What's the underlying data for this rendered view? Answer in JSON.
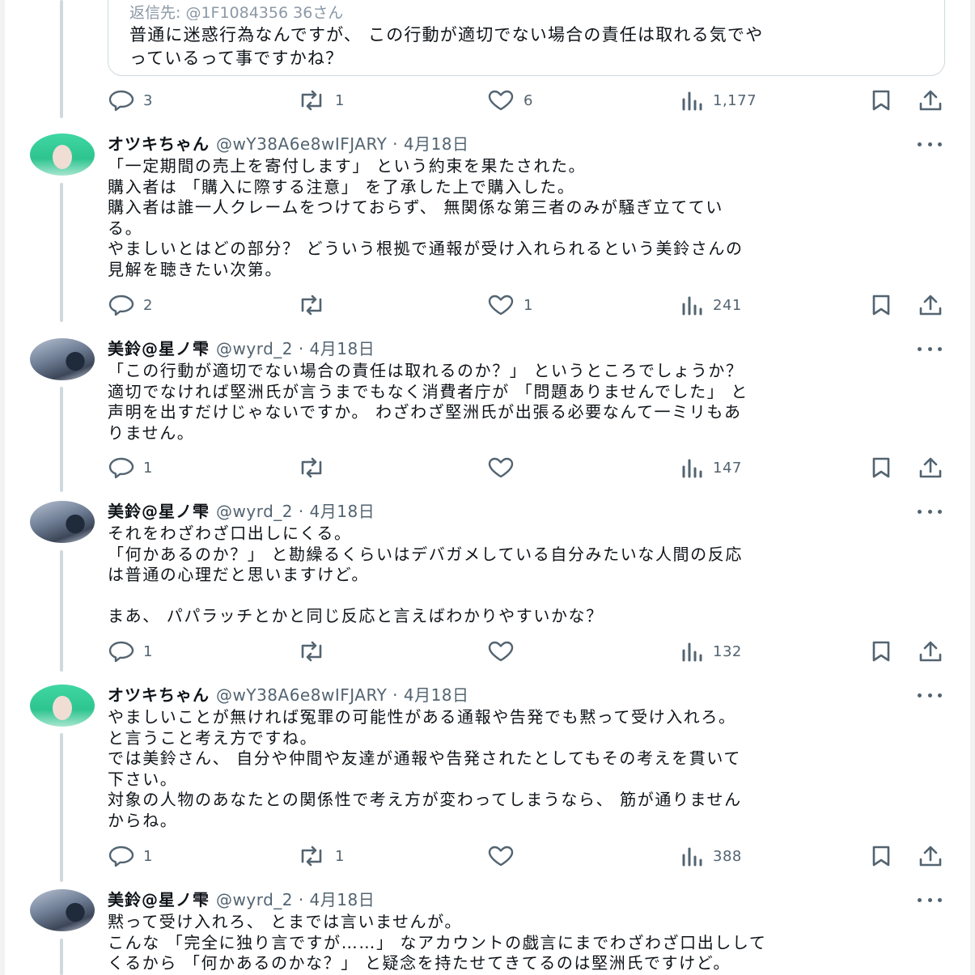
{
  "quote": {
    "reply_to": "返信先: @1F1084356 36さん",
    "text": "普通に迷惑行為なんですが、 この行動が適切でない場合の責任は取れる気でや\nっているって事ですかね？",
    "replies": "3",
    "reposts": "1",
    "likes": "6",
    "views": "1,177"
  },
  "tweets": [
    {
      "name": "オツキちゃん",
      "handle": "@wY38A6e8wIFJARY · 4月18日",
      "text": "「一定期間の売上を寄付します」 という約束を果たされた。\n購入者は 「購入に際する注意」 を了承した上で購入した。\n購入者は誰一人クレームをつけておらず、 無関係な第三者のみが騒ぎ立ててい\nる。\nやましいとはどの部分？ どういう根拠で通報が受け入れられるという美鈴さんの\n見解を聴きたい次第。",
      "replies": "2",
      "reposts": "",
      "likes": "1",
      "views": "241"
    },
    {
      "name": "美鈴@星ノ雫",
      "handle": "@wyrd_2 · 4月18日",
      "text": "「この行動が適切でない場合の責任は取れるのか？」 というところでしょうか？\n適切でなければ堅洲氏が言うまでもなく消費者庁が 「問題ありませんでした」 と\n声明を出すだけじゃないですか。 わざわざ堅洲氏が出張る必要なんて一ミリもあ\nりません。",
      "replies": "1",
      "reposts": "",
      "likes": "",
      "views": "147"
    },
    {
      "name": "美鈴@星ノ雫",
      "handle": "@wyrd_2 · 4月18日",
      "text": "それをわざわざ口出しにくる。\n「何かあるのか？」 と勘繰るくらいはデバガメしている自分みたいな人間の反応\nは普通の心理だと思いますけど。\n\nまあ、 パパラッチとかと同じ反応と言えばわかりやすいかな？",
      "replies": "1",
      "reposts": "",
      "likes": "",
      "views": "132"
    },
    {
      "name": "オツキちゃん",
      "handle": "@wY38A6e8wIFJARY · 4月18日",
      "text": "やましいことが無ければ冤罪の可能性がある通報や告発でも黙って受け入れろ。\nと言うこと考え方ですね。\nでは美鈴さん、 自分や仲間や友達が通報や告発されたとしてもその考えを貫いて\n下さい。\n対象の人物のあなたとの関係性で考え方が変わってしまうなら、 筋が通りません\nからね。",
      "replies": "1",
      "reposts": "1",
      "likes": "",
      "views": "388"
    },
    {
      "name": "美鈴@星ノ雫",
      "handle": "@wyrd_2 · 4月18日",
      "text": "黙って受け入れろ、 とまでは言いませんが。\nこんな 「完全に独り言ですが……」 なアカウントの戯言にまでわざわざ口出しして\nくるから 「何かあるのかな？」 と疑念を持たせてきてるのは堅洲氏ですけど。",
      "replies": "",
      "reposts": "",
      "likes": "",
      "views": ""
    }
  ],
  "icons": {
    "reply": "reply-icon",
    "repost": "repost-icon",
    "like": "like-icon",
    "views": "views-icon",
    "bookmark": "bookmark-icon",
    "share": "share-icon",
    "more": "more-icon"
  },
  "colors": {
    "text": "#0f1419",
    "secondary": "#536471",
    "border": "#cfd9de",
    "avatar_green": "#2ec490"
  }
}
